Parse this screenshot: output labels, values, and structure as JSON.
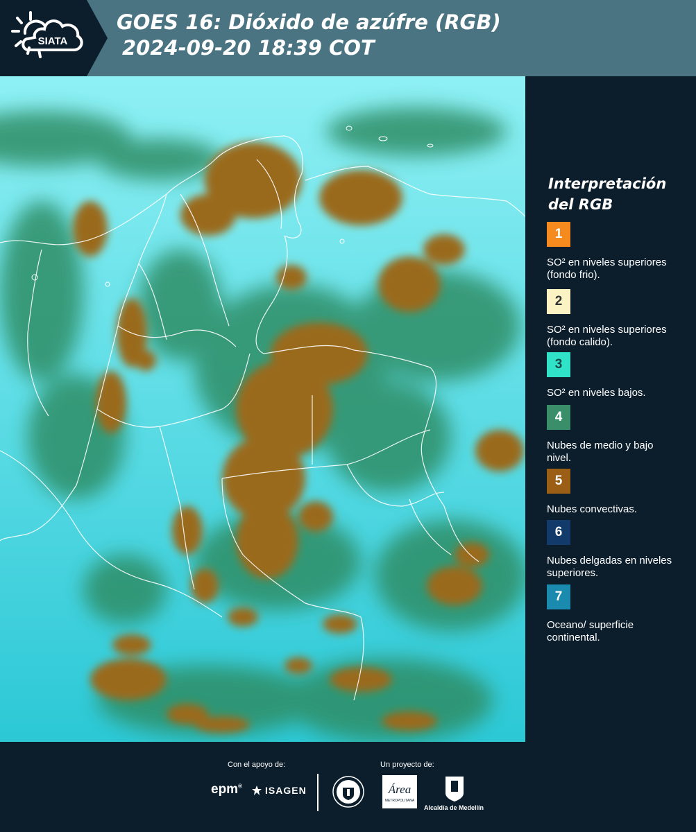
{
  "header": {
    "logo_text": "SIATA",
    "title": "GOES 16: Dióxido de azúfre (RGB)",
    "subtitle": "2024-09-20 18:39 COT"
  },
  "legend": {
    "title": "Interpretación del RGB",
    "items": [
      {
        "number": "1",
        "color": "#f58a1f",
        "label": "SO² en niveles superiores (fondo frio)."
      },
      {
        "number": "2",
        "color": "#fbf3c4",
        "label": "SO² en niveles superiores (fondo calido)."
      },
      {
        "number": "3",
        "color": "#2fe2c8",
        "label": "SO² en niveles bajos."
      },
      {
        "number": "4",
        "color": "#3a8f6a",
        "label": "Nubes de medio y bajo nivel."
      },
      {
        "number": "5",
        "color": "#9a5e14",
        "label": "Nubes convectivas."
      },
      {
        "number": "6",
        "color": "#123a6a",
        "label": "Nubes delgadas en niveles superiores."
      },
      {
        "number": "7",
        "color": "#1a8aae",
        "label": "Oceano/ superficie continental."
      }
    ]
  },
  "footer": {
    "support_label": "Con el apoyo de:",
    "project_label": "Un proyecto de:",
    "epm_logo": "epm",
    "isagen_logo": "ISAGEN",
    "area_logo": "Área",
    "area_sub": "METROPOLITANA",
    "alcaldia_logo": "Alcaldía de Medellín"
  }
}
